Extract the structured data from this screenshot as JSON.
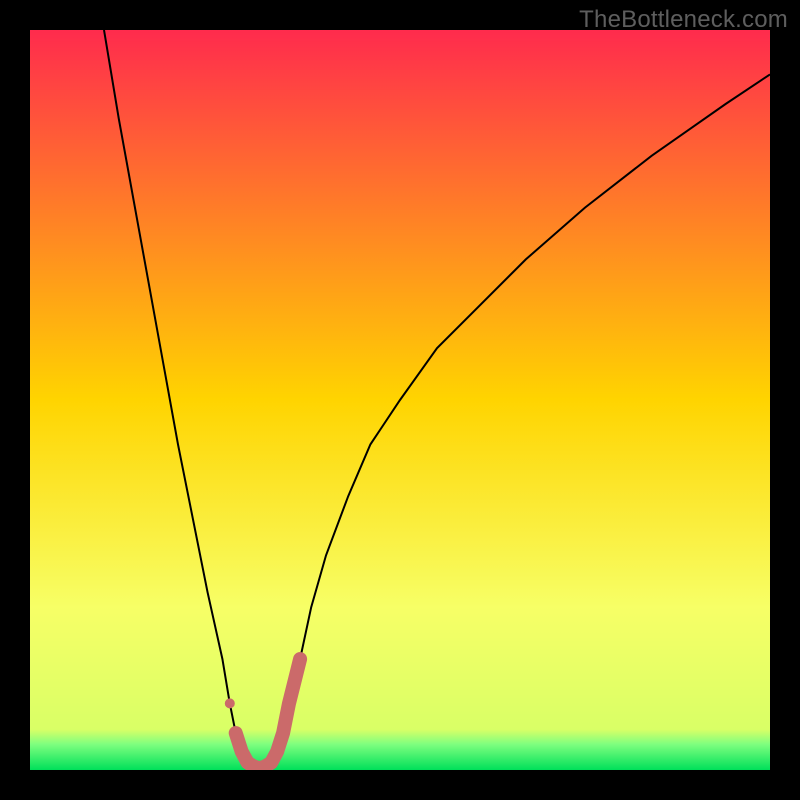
{
  "watermark": "TheBottleneck.com",
  "chart_data": {
    "type": "line",
    "title": "",
    "xlabel": "",
    "ylabel": "",
    "xlim": [
      0,
      100
    ],
    "ylim": [
      0,
      100
    ],
    "grid": false,
    "legend": false,
    "background_gradient": {
      "stops": [
        {
          "offset": 0.0,
          "color": "#ff2b4d"
        },
        {
          "offset": 0.5,
          "color": "#ffd400"
        },
        {
          "offset": 0.78,
          "color": "#f7ff66"
        },
        {
          "offset": 0.945,
          "color": "#d9ff66"
        },
        {
          "offset": 0.965,
          "color": "#7fff7f"
        },
        {
          "offset": 1.0,
          "color": "#00e05a"
        }
      ]
    },
    "series": [
      {
        "name": "main-curve",
        "stroke": "#000000",
        "stroke_width": 2,
        "x": [
          10,
          12,
          14,
          16,
          18,
          20,
          22,
          24,
          26,
          27,
          27.8,
          28.6,
          29.4,
          30.2,
          31,
          31.8,
          32.6,
          33.4,
          34.2,
          35,
          36.5,
          38,
          40,
          43,
          46,
          50,
          55,
          60,
          67,
          75,
          84,
          94,
          100
        ],
        "y": [
          100,
          88,
          77,
          66,
          55,
          44,
          34,
          24,
          15,
          9,
          5,
          2.5,
          1,
          0.5,
          0.2,
          0.5,
          1,
          2.5,
          5,
          9,
          15,
          22,
          29,
          37,
          44,
          50,
          57,
          62,
          69,
          76,
          83,
          90,
          94
        ]
      },
      {
        "name": "marker-dot",
        "type": "scatter",
        "color": "#cb6a6a",
        "size": 10,
        "x": [
          27
        ],
        "y": [
          9
        ]
      },
      {
        "name": "highlight-band",
        "stroke": "#cb6a6a",
        "stroke_width": 14,
        "x": [
          27.8,
          28.6,
          29.4,
          30.2,
          31,
          31.8,
          32.6,
          33.4,
          34.2,
          35,
          36.5
        ],
        "y": [
          5,
          2.5,
          1,
          0.5,
          0.2,
          0.5,
          1,
          2.5,
          5,
          9,
          15
        ]
      }
    ]
  }
}
